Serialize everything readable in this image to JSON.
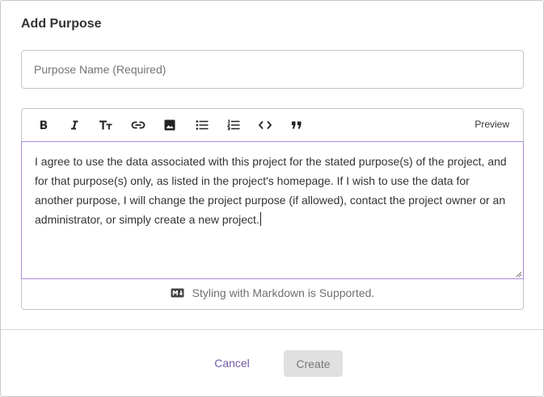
{
  "dialog": {
    "title": "Add Purpose",
    "name_field": {
      "placeholder": "Purpose Name (Required)",
      "value": ""
    },
    "editor": {
      "toolbar": [
        {
          "name": "bold-icon"
        },
        {
          "name": "italic-icon"
        },
        {
          "name": "text-size-icon"
        },
        {
          "name": "link-icon"
        },
        {
          "name": "image-icon"
        },
        {
          "name": "bulleted-list-icon"
        },
        {
          "name": "numbered-list-icon"
        },
        {
          "name": "code-icon"
        },
        {
          "name": "quote-icon"
        }
      ],
      "preview_label": "Preview",
      "body_text": "I agree to use the data associated with this project for the stated purpose(s) of the project, and for that purpose(s) only, as listed in the project's homepage. If I wish to use the data for another purpose, I will change the project purpose (if allowed), contact the project owner or an administrator, or simply create a new project.",
      "markdown_note": "Styling with Markdown is Supported."
    },
    "actions": {
      "cancel_label": "Cancel",
      "create_label": "Create"
    },
    "colors": {
      "accent": "#6e5aa8",
      "focus_border": "#a98bd9",
      "disabled_bg": "#e0e0e0"
    }
  }
}
